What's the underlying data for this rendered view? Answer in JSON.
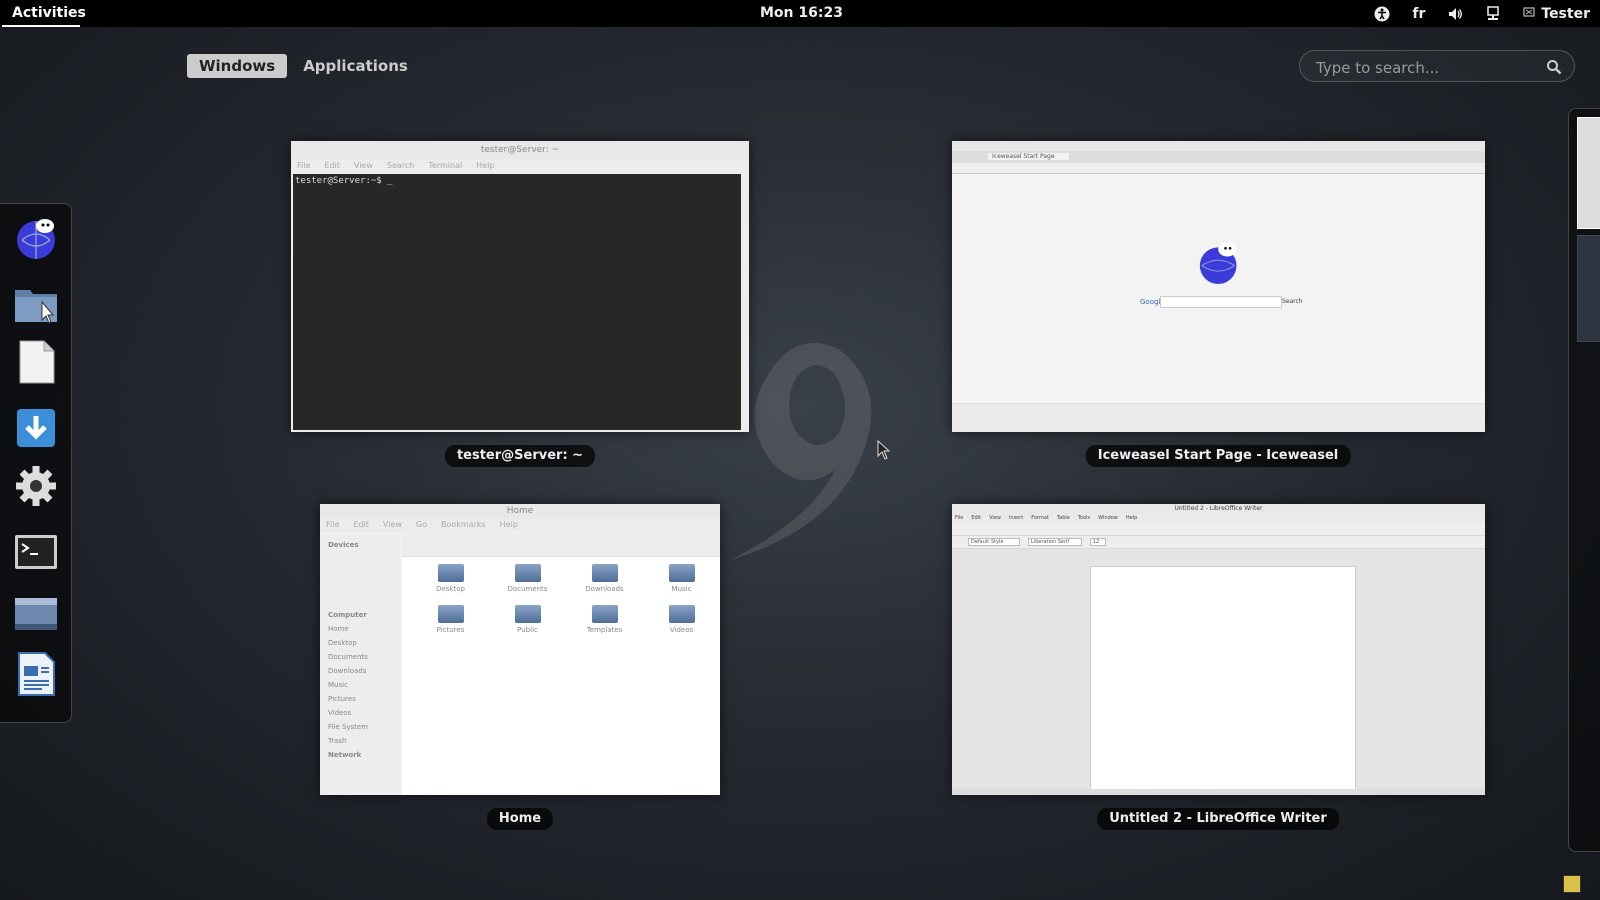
{
  "topbar": {
    "activities_label": "Activities",
    "clock": "Mon 16:23",
    "keyboard_layout": "fr",
    "user_name": "Tester"
  },
  "overview": {
    "tabs": [
      {
        "label": "Windows",
        "active": true
      },
      {
        "label": "Applications",
        "active": false
      }
    ],
    "search_placeholder": "Type to search..."
  },
  "dash": {
    "items": [
      {
        "icon": "iceweasel-icon",
        "app": "Iceweasel"
      },
      {
        "icon": "files-icon",
        "app": "Files"
      },
      {
        "icon": "blank-document-icon",
        "app": "Documents"
      },
      {
        "icon": "download-icon",
        "app": "Software"
      },
      {
        "icon": "settings-gear-icon",
        "app": "Settings"
      },
      {
        "icon": "terminal-icon",
        "app": "Terminal"
      },
      {
        "icon": "desktop-window-icon",
        "app": "Desktop"
      },
      {
        "icon": "writer-icon",
        "app": "LibreOffice Writer"
      }
    ]
  },
  "windows": [
    {
      "caption": "tester@Server: ~",
      "title": "tester@Server: ~",
      "menu": [
        "File",
        "Edit",
        "View",
        "Search",
        "Terminal",
        "Help"
      ],
      "prompt": "tester@Server:~$ _"
    },
    {
      "caption": "Iceweasel Start Page - Iceweasel",
      "title": "Iceweasel Start Page - Iceweasel",
      "tab_label": "Iceweasel Start Page",
      "search_button": "Search",
      "google_label": "Google"
    },
    {
      "caption": "Home",
      "title": "Home",
      "menu": [
        "File",
        "Edit",
        "View",
        "Go",
        "Bookmarks",
        "Help"
      ],
      "sidebar_sections": [
        "Devices",
        "Computer",
        "Network"
      ],
      "sidebar_items": [
        "Home",
        "Desktop",
        "Documents",
        "Downloads",
        "Music",
        "Pictures",
        "Videos",
        "File System",
        "Trash"
      ],
      "folders": [
        "Desktop",
        "Documents",
        "Downloads",
        "Music",
        "Pictures",
        "Public",
        "Templates",
        "Videos"
      ]
    },
    {
      "caption": "Untitled 2 - LibreOffice Writer",
      "title": "Untitled 2 - LibreOffice Writer",
      "menu": [
        "File",
        "Edit",
        "View",
        "Insert",
        "Format",
        "Table",
        "Tools",
        "Window",
        "Help"
      ],
      "style_box": "Default Style",
      "font_box": "Liberation Serif",
      "size_box": "12"
    }
  ],
  "colors": {
    "topbar": "#000000",
    "tab_active_bg": "#cccccc",
    "background": "#262a31"
  }
}
